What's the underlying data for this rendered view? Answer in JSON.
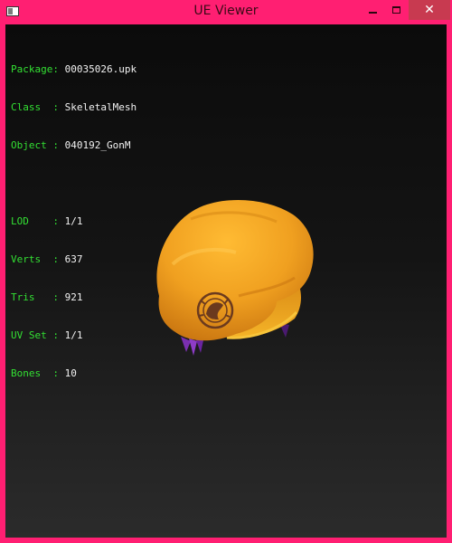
{
  "window": {
    "title": "UE Viewer",
    "controls": {
      "minimize": "minimize",
      "maximize": "maximize",
      "close": "close"
    }
  },
  "info": {
    "package": {
      "label": "Package: ",
      "value": "00035026.upk"
    },
    "class": {
      "label": "Class  : ",
      "value": "SkeletalMesh"
    },
    "object": {
      "label": "Object : ",
      "value": "040192_GonM"
    },
    "lod": {
      "label": "LOD    : ",
      "value": "1/1"
    },
    "verts": {
      "label": "Verts  : ",
      "value": "637"
    },
    "tris": {
      "label": "Tris   : ",
      "value": "921"
    },
    "uvset": {
      "label": "UV Set : ",
      "value": "1/1"
    },
    "bones": {
      "label": "Bones  : ",
      "value": "10"
    }
  },
  "colors": {
    "frame": "#ff1f72",
    "label_text": "#33e033",
    "value_text": "#f2f2f2",
    "hat": "#f0a020",
    "emblem": "#6b3a1e",
    "feather": "#7a2fb0"
  },
  "viewport": {
    "model_icon": "yellow-beret-model"
  }
}
